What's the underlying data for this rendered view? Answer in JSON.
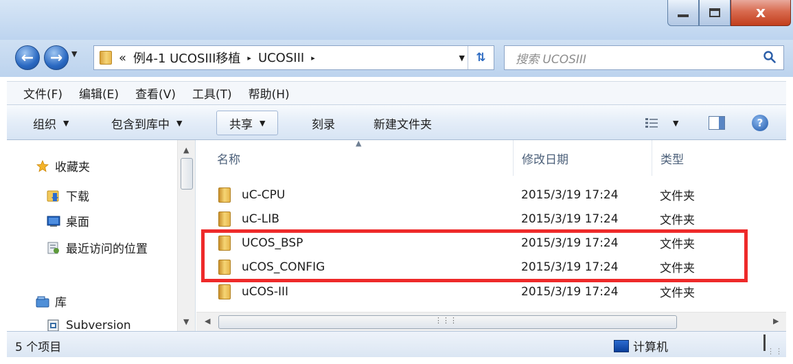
{
  "window": {
    "close_glyph": "x"
  },
  "nav": {
    "breadcrumb_prefix": "«",
    "breadcrumb": [
      "例4-1 UCOSIII移植",
      "UCOSIII"
    ],
    "crumb_separator": "▸",
    "search_placeholder": "搜索 UCOSIII"
  },
  "menu": [
    "文件(F)",
    "编辑(E)",
    "查看(V)",
    "工具(T)",
    "帮助(H)"
  ],
  "toolbar": {
    "organize": "组织",
    "include_library": "包含到库中",
    "share": "共享",
    "burn": "刻录",
    "new_folder": "新建文件夹"
  },
  "sidebar": {
    "favorites": "收藏夹",
    "downloads": "下载",
    "desktop": "桌面",
    "recent": "最近访问的位置",
    "libraries": "库",
    "subversion": "Subversion"
  },
  "columns": {
    "name": "名称",
    "date": "修改日期",
    "type": "类型"
  },
  "files": [
    {
      "name": "uC-CPU",
      "date": "2015/3/19 17:24",
      "type": "文件夹"
    },
    {
      "name": "uC-LIB",
      "date": "2015/3/19 17:24",
      "type": "文件夹"
    },
    {
      "name": "UCOS_BSP",
      "date": "2015/3/19 17:24",
      "type": "文件夹"
    },
    {
      "name": "uCOS_CONFIG",
      "date": "2015/3/19 17:24",
      "type": "文件夹"
    },
    {
      "name": "uCOS-III",
      "date": "2015/3/19 17:24",
      "type": "文件夹"
    }
  ],
  "status": {
    "count": "5 个项目",
    "zone": "计算机"
  },
  "colors": {
    "highlight": "#ee2a2a",
    "accent": "#2a69c2"
  },
  "icons": {
    "favorites": "star-icon",
    "downloads": "download-folder-icon",
    "desktop": "desktop-icon",
    "recent": "recent-places-icon",
    "libraries": "library-icon",
    "subversion": "subversion-icon",
    "files": "folder-icon",
    "computer": "computer-icon"
  }
}
